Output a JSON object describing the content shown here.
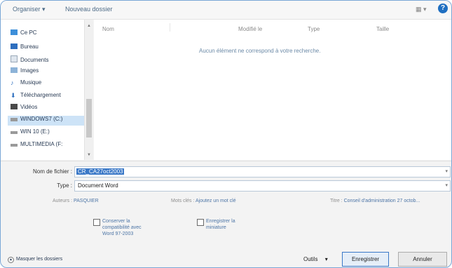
{
  "toolbar": {
    "organiser": "Organiser ▾",
    "new_folder": "Nouveau dossier",
    "view_menu": "▦ ▾",
    "help": "?"
  },
  "nav": {
    "items": [
      {
        "label": "Ce PC",
        "icon": "computer-icon"
      },
      {
        "label": "Bureau",
        "icon": "desktop-icon"
      },
      {
        "label": "Documents",
        "icon": "documents-icon"
      },
      {
        "label": "Images",
        "icon": "images-icon"
      },
      {
        "label": "Musique",
        "icon": "music-icon"
      },
      {
        "label": "Téléchargement",
        "icon": "download-icon"
      },
      {
        "label": "Vidéos",
        "icon": "video-icon"
      },
      {
        "label": "WINDOWS7 (C:)",
        "icon": "drive-icon"
      },
      {
        "label": "WIN 10 (E:)",
        "icon": "drive-icon"
      },
      {
        "label": "MULTIMEDIA (F:",
        "icon": "drive-icon"
      }
    ]
  },
  "files": {
    "columns": {
      "name": "Nom",
      "modified": "Modifié le",
      "type": "Type",
      "size": "Taille"
    },
    "empty_message": "Aucun élément ne correspond à votre recherche."
  },
  "form": {
    "filename_label": "Nom de fichier :",
    "filename_value": "CR_CA27oct2003",
    "type_label": "Type :",
    "type_value": "Document Word"
  },
  "meta": {
    "authors_label": "Auteurs :",
    "authors_value": "PASQUIER",
    "keywords_label": "Mots clés :",
    "keywords_value": "Ajoutez un mot clé",
    "title_label": "Titre :",
    "title_value": "Conseil d'administration 27 octob..."
  },
  "options": {
    "compat_label": "Conserver la compatibilité avec Word 97-2003",
    "thumbnail_label": "Enregistrer la miniature"
  },
  "footer": {
    "hide_folders": "Masquer les dossiers",
    "tools": "Outils",
    "tools_arrow": "▾",
    "save": "Enregistrer",
    "cancel": "Annuler"
  }
}
